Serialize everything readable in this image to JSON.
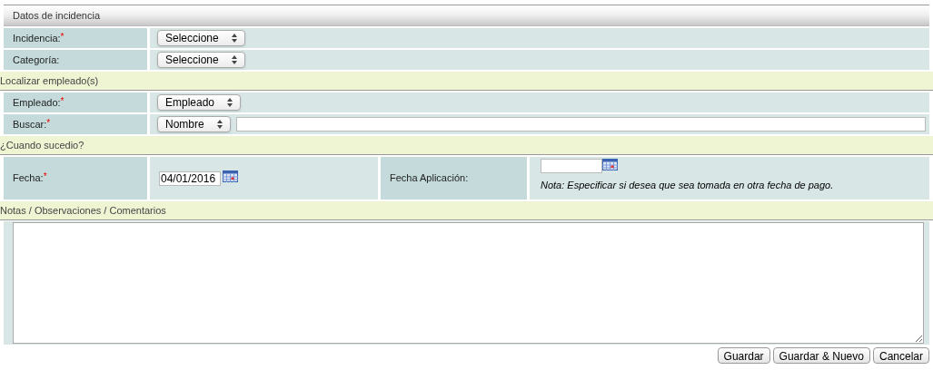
{
  "header": {
    "title": "Datos de incidencia"
  },
  "sections": [
    {
      "kind": "rows",
      "rows": [
        {
          "label": "Incidencia:",
          "required_mark": "*",
          "select": "Seleccione"
        },
        {
          "label": "Categoría:",
          "select": "Seleccione"
        }
      ]
    },
    {
      "kind": "title",
      "title": "Localizar empleado(s)"
    },
    {
      "kind": "rows",
      "rows": [
        {
          "label": "Empleado:",
          "required_mark": "*",
          "select": "Empleado"
        },
        {
          "label": "Buscar:",
          "required_mark": "*",
          "select": "Nombre",
          "search_field": true
        }
      ]
    },
    {
      "kind": "title",
      "title": "¿Cuando sucedio?"
    },
    {
      "kind": "dates",
      "fecha": {
        "label": "Fecha:",
        "required_mark": "*",
        "value": "04/01/2016"
      },
      "aplicacion": {
        "label": "Fecha Aplicación:",
        "note": "Nota: Especificar si desea que sea tomada en otra fecha de pago."
      }
    },
    {
      "kind": "title",
      "title": "Notas / Observaciones / Comentarios"
    },
    {
      "kind": "notes"
    }
  ],
  "buttons": [
    "Guardar",
    "Guardar & Nuevo",
    "Cancelar"
  ]
}
